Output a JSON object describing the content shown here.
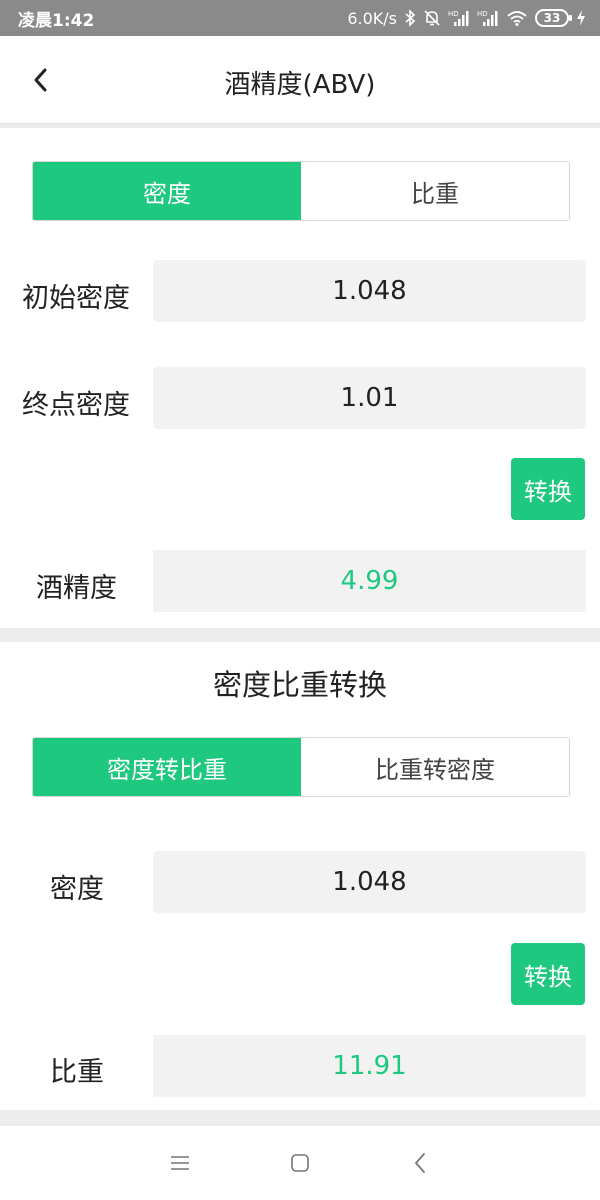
{
  "status_bar": {
    "time": "凌晨1:42",
    "speed": "6.0K/s",
    "battery": "33",
    "icons": [
      "bluetooth-icon",
      "mute-bell-icon",
      "signal-hd-icon",
      "signal-hd-icon",
      "wifi-icon",
      "battery-icon",
      "charging-icon"
    ]
  },
  "header": {
    "title": "酒精度(ABV)",
    "back_icon": "chevron-left-icon"
  },
  "abv_card": {
    "tabs": [
      {
        "label": "密度",
        "active": true
      },
      {
        "label": "比重",
        "active": false
      }
    ],
    "initial_label": "初始密度",
    "initial_value": "1.048",
    "final_label": "终点密度",
    "final_value": "1.01",
    "convert_label": "转换",
    "result_label": "酒精度",
    "result_value": "4.99"
  },
  "conversion_card": {
    "title": "密度比重转换",
    "tabs": [
      {
        "label": "密度转比重",
        "active": true
      },
      {
        "label": "比重转密度",
        "active": false
      }
    ],
    "input_label": "密度",
    "input_value": "1.048",
    "convert_label": "转换",
    "result_label": "比重",
    "result_value": "11.91"
  },
  "colors": {
    "accent": "#1ec97f",
    "status_bar": "#8a8a8a",
    "field_bg": "#f2f2f2",
    "page_bg": "#ececec"
  },
  "nav_bar": {
    "icons": [
      "menu-icon",
      "home-square-icon",
      "back-triangle-icon"
    ]
  }
}
